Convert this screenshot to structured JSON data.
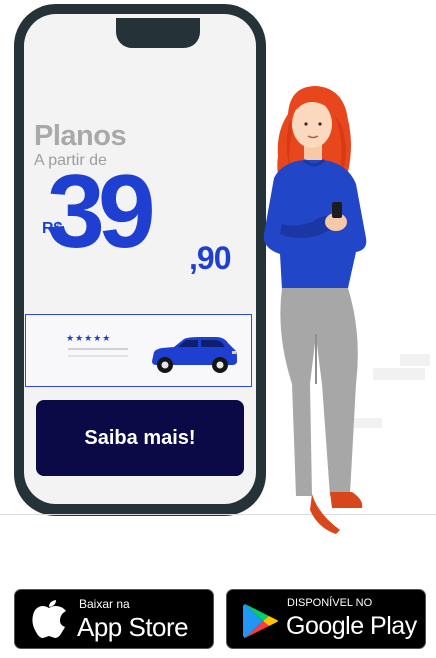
{
  "plan": {
    "title": "Planos",
    "subtitle": "A partir de",
    "currency": "R$",
    "price_integer": "39",
    "price_decimal": ",90"
  },
  "card": {
    "stars": "★★★★★"
  },
  "cta": {
    "label": "Saiba mais!"
  },
  "stores": {
    "apple": {
      "small": "Baixar na",
      "big": "App Store"
    },
    "google": {
      "small": "DISPONÍVEL NO",
      "big": "Google Play"
    }
  },
  "colors": {
    "accent": "#1f3fd1",
    "button": "#0b0a47",
    "phone_frame": "#253338",
    "car": "#1e3fd0",
    "hair": "#e8471e",
    "sweater": "#2146c7",
    "pants": "#a7a7a7"
  }
}
